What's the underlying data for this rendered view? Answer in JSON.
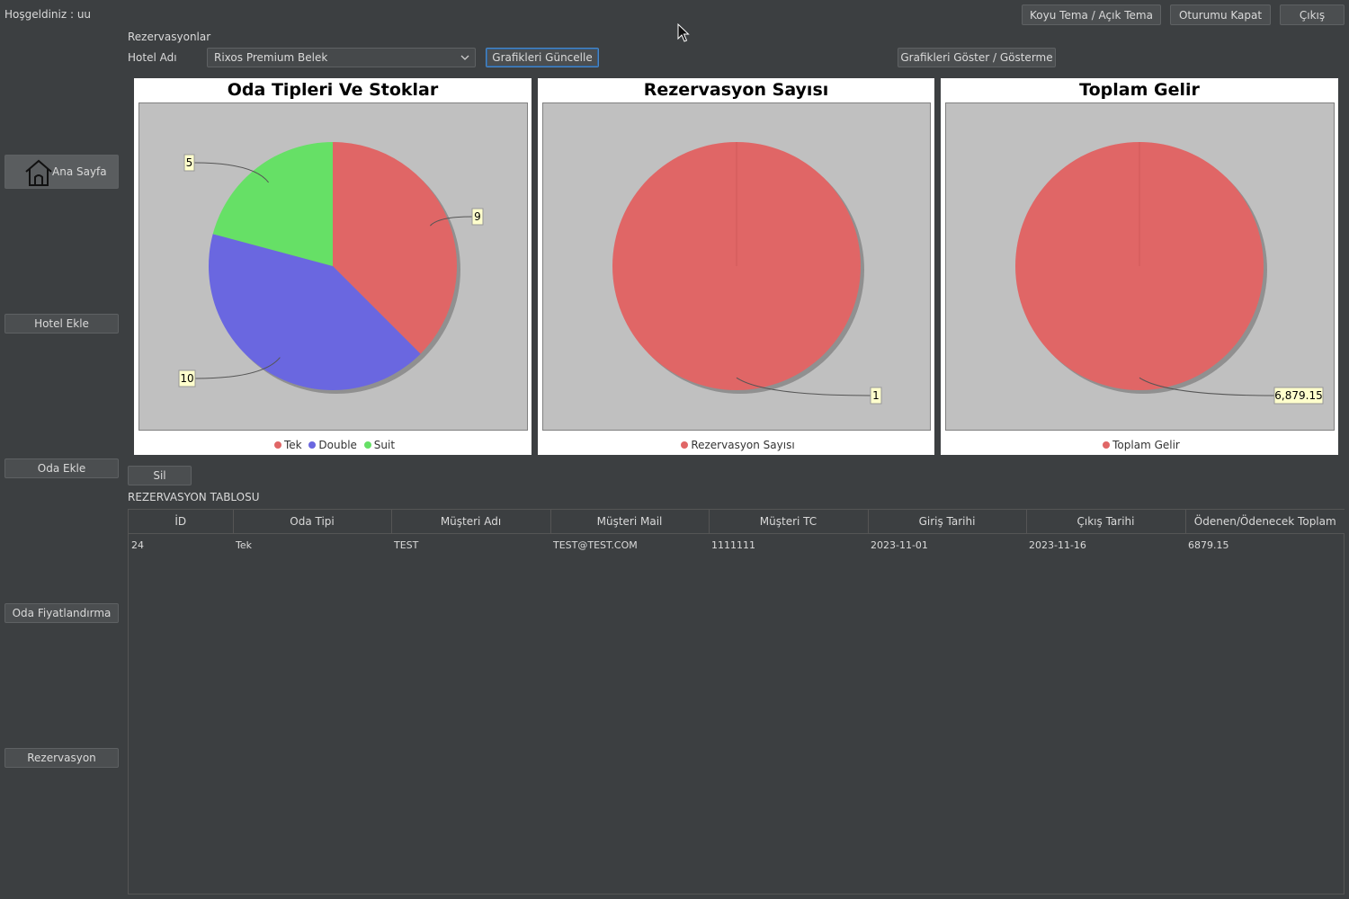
{
  "header": {
    "welcome": "Hoşgeldiniz : uu",
    "theme_button": "Koyu Tema / Açık Tema",
    "logout_button": "Oturumu Kapat",
    "exit_button": "Çıkış"
  },
  "sidebar": {
    "items": [
      {
        "label": "Ana Sayfa",
        "icon": "home-icon"
      },
      {
        "label": "Hotel Ekle"
      },
      {
        "label": "Oda Ekle"
      },
      {
        "label": "Oda Fiyatlandırma"
      },
      {
        "label": "Rezervasyon"
      }
    ]
  },
  "main": {
    "section_title": "Rezervasyonlar",
    "hotel_label": "Hotel Adı",
    "hotel_selected": "Rixos Premium Belek",
    "update_charts_button": "Grafikleri Güncelle",
    "toggle_charts_button": "Grafikleri Göster / Gösterme",
    "delete_button": "Sil",
    "table_title": "REZERVASYON TABLOSU"
  },
  "table": {
    "columns": [
      "İD",
      "Oda Tipi",
      "Müşteri Adı",
      "Müşteri Mail",
      "Müşteri TC",
      "Giriş Tarihi",
      "Çıkış Tarihi",
      "Ödenen/Ödenecek Toplam"
    ],
    "rows": [
      [
        "24",
        "Tek",
        "TEST",
        "TEST@TEST.COM",
        "1111111",
        "2023-11-01",
        "2023-11-16",
        "6879.15"
      ]
    ]
  },
  "colors": {
    "background": "#3c3f41",
    "red": "#e06666",
    "blue": "#6a67e0",
    "green": "#66e066",
    "label_bg": "#ffffcc"
  },
  "chart_data": [
    {
      "type": "pie",
      "title": "Oda Tipleri Ve Stoklar",
      "categories": [
        "Tek",
        "Double",
        "Suit"
      ],
      "values": [
        9,
        10,
        5
      ],
      "labels": [
        "9",
        "10",
        "5"
      ],
      "colors": [
        "#e06666",
        "#6a67e0",
        "#66e066"
      ],
      "legend": "bottom"
    },
    {
      "type": "pie",
      "title": "Rezervasyon Sayısı",
      "categories": [
        "Rezervasyon Sayısı"
      ],
      "values": [
        1
      ],
      "labels": [
        "1"
      ],
      "colors": [
        "#e06666"
      ],
      "legend": "bottom"
    },
    {
      "type": "pie",
      "title": "Toplam Gelir",
      "categories": [
        "Toplam Gelir"
      ],
      "values": [
        6879.15
      ],
      "labels": [
        "6,879.15"
      ],
      "colors": [
        "#e06666"
      ],
      "legend": "bottom"
    }
  ]
}
